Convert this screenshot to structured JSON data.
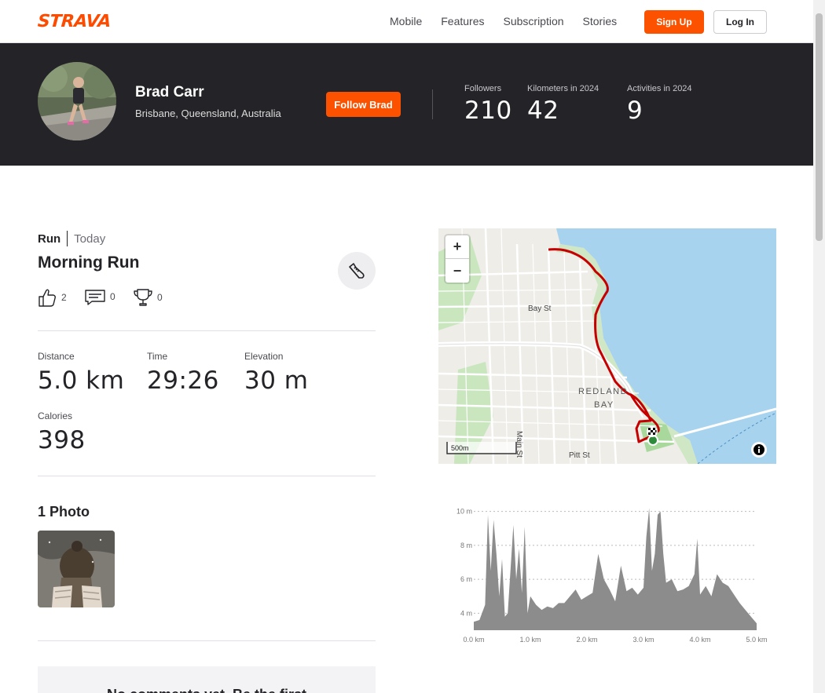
{
  "nav": {
    "logo": "STRAVA",
    "links": [
      "Mobile",
      "Features",
      "Subscription",
      "Stories"
    ],
    "signup": "Sign Up",
    "login": "Log In"
  },
  "athlete": {
    "name": "Brad Carr",
    "location": "Brisbane, Queensland, Australia",
    "follow": "Follow Brad",
    "stats": [
      {
        "label": "Followers",
        "value": "210"
      },
      {
        "label": "Kilometers in 2024",
        "value": "42"
      },
      {
        "label": "Activities in 2024",
        "value": "9"
      }
    ]
  },
  "activity": {
    "type": "Run",
    "date": "Today",
    "title": "Morning Run",
    "kudos": "2",
    "comments": "0",
    "achievements": "0",
    "metrics": [
      {
        "label": "Distance",
        "value": "5.0 km"
      },
      {
        "label": "Time",
        "value": "29:26"
      },
      {
        "label": "Elevation",
        "value": "30 m"
      },
      {
        "label": "Calories",
        "value": "398"
      }
    ],
    "photos_title": "1 Photo",
    "no_comments": "No comments yet. Be the first"
  },
  "map": {
    "labels": [
      "Bay St",
      "REDLAND",
      "BAY",
      "Main St",
      "Pitt St"
    ],
    "scale": "500m"
  },
  "chart_data": {
    "type": "area",
    "title": "",
    "xlabel": "",
    "ylabel": "",
    "x_ticks": [
      "0.0 km",
      "1.0 km",
      "2.0 km",
      "3.0 km",
      "4.0 km",
      "5.0 km"
    ],
    "y_ticks": [
      "4 m",
      "6 m",
      "8 m",
      "10 m"
    ],
    "xlim": [
      0,
      5
    ],
    "ylim": [
      3,
      11
    ],
    "x": [
      0,
      0.1,
      0.2,
      0.25,
      0.3,
      0.35,
      0.4,
      0.45,
      0.5,
      0.55,
      0.6,
      0.7,
      0.75,
      0.8,
      0.85,
      0.9,
      0.95,
      1.0,
      1.1,
      1.2,
      1.3,
      1.4,
      1.5,
      1.6,
      1.7,
      1.8,
      1.9,
      2.0,
      2.1,
      2.2,
      2.3,
      2.4,
      2.5,
      2.6,
      2.7,
      2.8,
      2.9,
      3.0,
      3.05,
      3.1,
      3.15,
      3.2,
      3.25,
      3.3,
      3.35,
      3.4,
      3.5,
      3.6,
      3.7,
      3.8,
      3.9,
      3.95,
      4.0,
      4.1,
      4.2,
      4.3,
      4.4,
      4.5,
      4.6,
      4.7,
      4.8,
      4.9,
      5.0
    ],
    "values": [
      3.5,
      3.6,
      4.5,
      9.8,
      6.5,
      9.5,
      7.5,
      5.0,
      7.2,
      3.8,
      4.0,
      9.2,
      6.0,
      7.8,
      5.2,
      9.1,
      4.0,
      5.0,
      4.5,
      4.2,
      4.4,
      4.3,
      4.6,
      4.6,
      5.0,
      5.4,
      4.8,
      5.0,
      5.2,
      7.5,
      6.0,
      5.4,
      4.7,
      6.8,
      5.3,
      5.5,
      5.1,
      5.5,
      8.5,
      10.2,
      6.5,
      7.5,
      9.8,
      10.0,
      7.5,
      5.8,
      6.0,
      5.3,
      5.4,
      5.6,
      6.3,
      8.4,
      5.1,
      5.6,
      5.0,
      6.3,
      5.8,
      5.6,
      5.1,
      4.6,
      4.2,
      3.8,
      3.4
    ]
  }
}
